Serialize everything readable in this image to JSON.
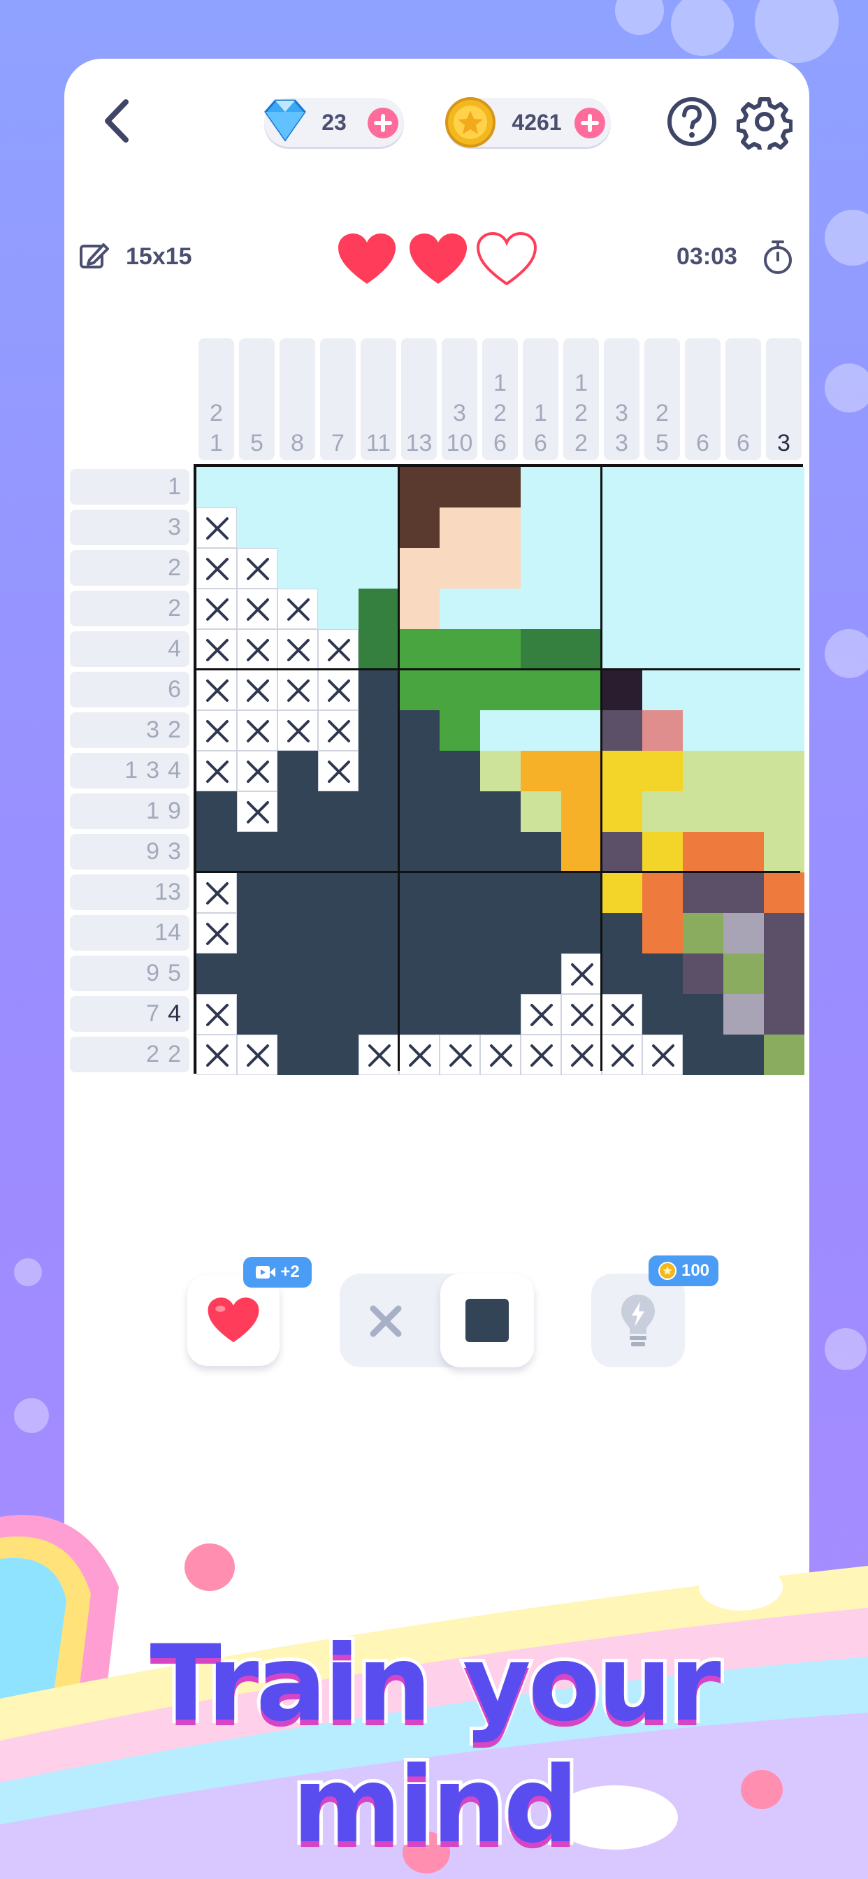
{
  "header": {
    "gems": "23",
    "coins": "4261"
  },
  "status": {
    "size": "15x15",
    "timer": "03:03",
    "lives": [
      true,
      true,
      false
    ]
  },
  "colors": {
    "accent": "#ff6b9a",
    "filled": "#344457",
    "heart": "#ff3d5a",
    "sky": "#c8f6fa"
  },
  "puzzle": {
    "columns": [
      {
        "nums": [
          "2",
          "1"
        ],
        "dark": false
      },
      {
        "nums": [
          "5"
        ],
        "dark": false
      },
      {
        "nums": [
          "8"
        ],
        "dark": false
      },
      {
        "nums": [
          "7"
        ],
        "dark": false
      },
      {
        "nums": [
          "11"
        ],
        "dark": false
      },
      {
        "nums": [
          "13"
        ],
        "dark": false
      },
      {
        "nums": [
          "3",
          "10"
        ],
        "dark": false
      },
      {
        "nums": [
          "1",
          "2",
          "6"
        ],
        "dark": false
      },
      {
        "nums": [
          "1",
          "6"
        ],
        "dark": false
      },
      {
        "nums": [
          "1",
          "2",
          "2"
        ],
        "dark": false
      },
      {
        "nums": [
          "3",
          "3"
        ],
        "dark": false
      },
      {
        "nums": [
          "2",
          "5"
        ],
        "dark": false
      },
      {
        "nums": [
          "6"
        ],
        "dark": false
      },
      {
        "nums": [
          "6"
        ],
        "dark": false
      },
      {
        "nums": [
          "3"
        ],
        "dark": true
      }
    ],
    "rows": [
      {
        "nums": [
          "1"
        ],
        "dark": false
      },
      {
        "nums": [
          "3"
        ],
        "dark": false
      },
      {
        "nums": [
          "2"
        ],
        "dark": false
      },
      {
        "nums": [
          "2"
        ],
        "dark": false
      },
      {
        "nums": [
          "4"
        ],
        "dark": false
      },
      {
        "nums": [
          "6"
        ],
        "dark": false
      },
      {
        "nums": [
          "3",
          "2"
        ],
        "dark": false
      },
      {
        "nums": [
          "1",
          "3",
          "4"
        ],
        "dark": false
      },
      {
        "nums": [
          "1",
          "9"
        ],
        "dark": false
      },
      {
        "nums": [
          "9",
          "3"
        ],
        "dark": false
      },
      {
        "nums": [
          "13"
        ],
        "dark": false
      },
      {
        "nums": [
          "14"
        ],
        "dark": false
      },
      {
        "nums": [
          "9",
          "5"
        ],
        "dark": false
      },
      {
        "nums": [
          "7",
          "4"
        ],
        "dark": false,
        "darkIndex": 1
      },
      {
        "nums": [
          "2",
          "2"
        ],
        "dark": false
      }
    ],
    "grid": [
      "SSSSSHHHSSSSSSS",
      "XSSSSHFFSSSSSSS",
      "XXSSSFFFSSSSSSS",
      "XXXSGFSSSSSSSSS",
      "XXXXGgggGGSSSSS",
      "XXXXDgggggPSSSS",
      "XXXXDDgSSSWRSSS",
      "XXDXDDDLOOYYLLL",
      "DXDDDDDDLOYLLLL",
      "DDDDDDDDDOMYCCL",
      "XDDDDDDDDDYCMMC",
      "XDDDDDDDDDDCEAM",
      "DDDDDDDDDXDDMEM",
      "XDDDDDDDXXXDDAM",
      "XXDDXXXXXXXXDDE"
    ],
    "palette": {
      "S": "#c8f6fa",
      "H": "#5a3a2e",
      "F": "#f9d9c0",
      "G": "#36803f",
      "g": "#49a540",
      "D": "#344457",
      "P": "#2a1d2f",
      "W": "#5c5068",
      "R": "#df8d8d",
      "L": "#cde39a",
      "O": "#f6b129",
      "Y": "#f3d52a",
      "M": "#5c5068",
      "C": "#ee7b3d",
      "E": "#8aac5e",
      "A": "#a9a3b6"
    }
  },
  "tools": {
    "heart_badge": "+2",
    "hint_cost": "100"
  },
  "banner": {
    "title": "Train your mind"
  }
}
